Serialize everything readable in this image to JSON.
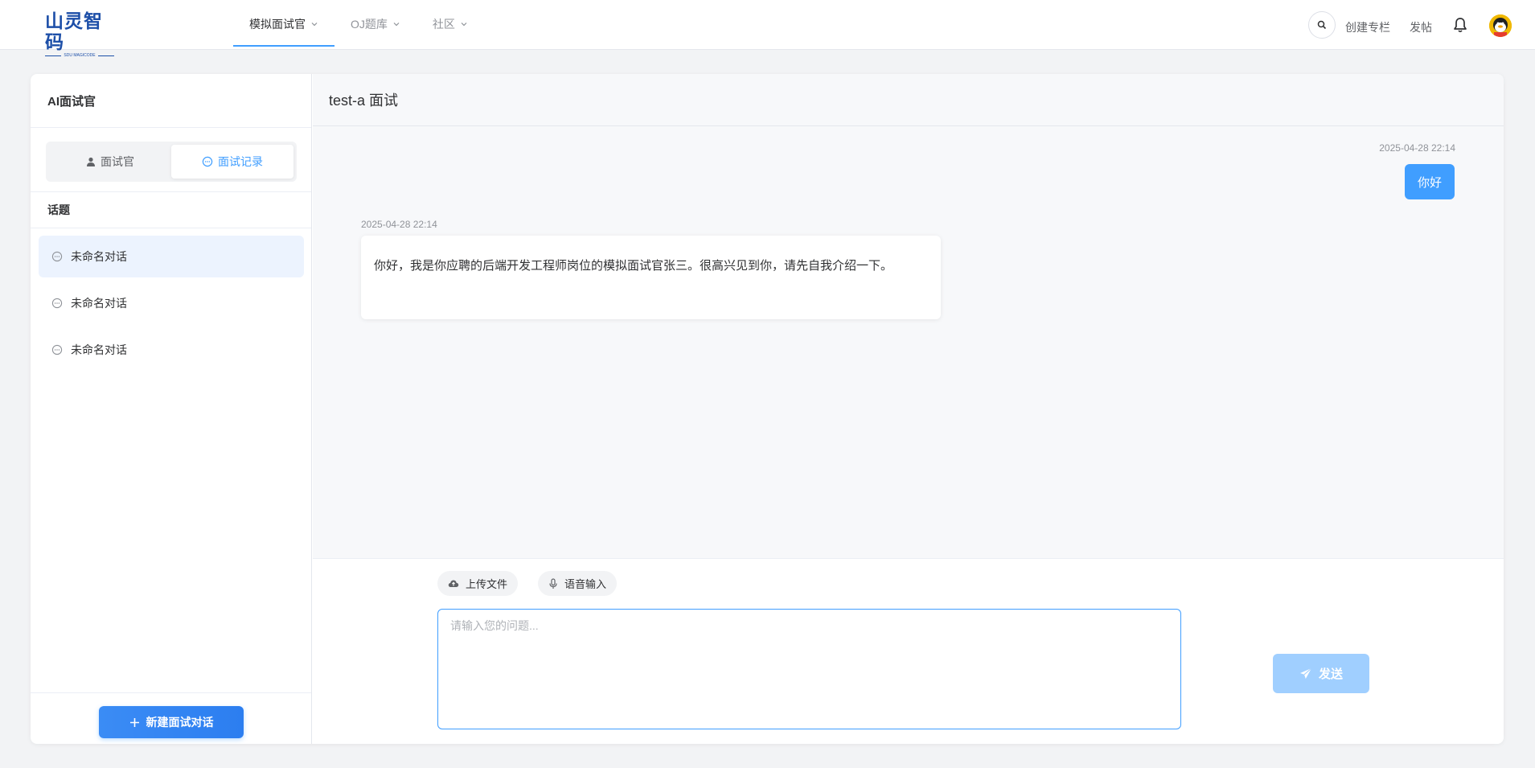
{
  "brand": {
    "name": "山灵智码",
    "tagline": "SDU MAGICODE",
    "color": "#1d4fa8"
  },
  "topnav": {
    "tabs": [
      {
        "label": "模拟面试官",
        "active": true
      },
      {
        "label": "OJ题库",
        "active": false
      },
      {
        "label": "社区",
        "active": false
      }
    ],
    "create_column_label": "创建专栏",
    "post_label": "发帖"
  },
  "sidebar": {
    "title": "AI面试官",
    "segments": [
      {
        "label": "面试官",
        "icon": "user-icon",
        "active": false
      },
      {
        "label": "面试记录",
        "icon": "chat-bubble-icon",
        "active": true
      }
    ],
    "topic_header": "话题",
    "conversations": [
      {
        "label": "未命名对话",
        "active": true
      },
      {
        "label": "未命名对话",
        "active": false
      },
      {
        "label": "未命名对话",
        "active": false
      }
    ],
    "new_button_label": "新建面试对话"
  },
  "chat": {
    "title": "test-a 面试",
    "messages": [
      {
        "role": "user",
        "time": "2025-04-28 22:14",
        "text": "你好"
      },
      {
        "role": "assistant",
        "time": "2025-04-28 22:14",
        "text": "你好，我是你应聘的后端开发工程师岗位的模拟面试官张三。很高兴见到你，请先自我介绍一下。"
      }
    ],
    "upload_label": "上传文件",
    "voice_label": "语音输入",
    "input_placeholder": "请输入您的问题...",
    "input_value": "",
    "send_label": "发送"
  },
  "colors": {
    "accent": "#409eff",
    "send_disabled": "#a0cfff",
    "active_item_bg": "#ecf3fe"
  }
}
